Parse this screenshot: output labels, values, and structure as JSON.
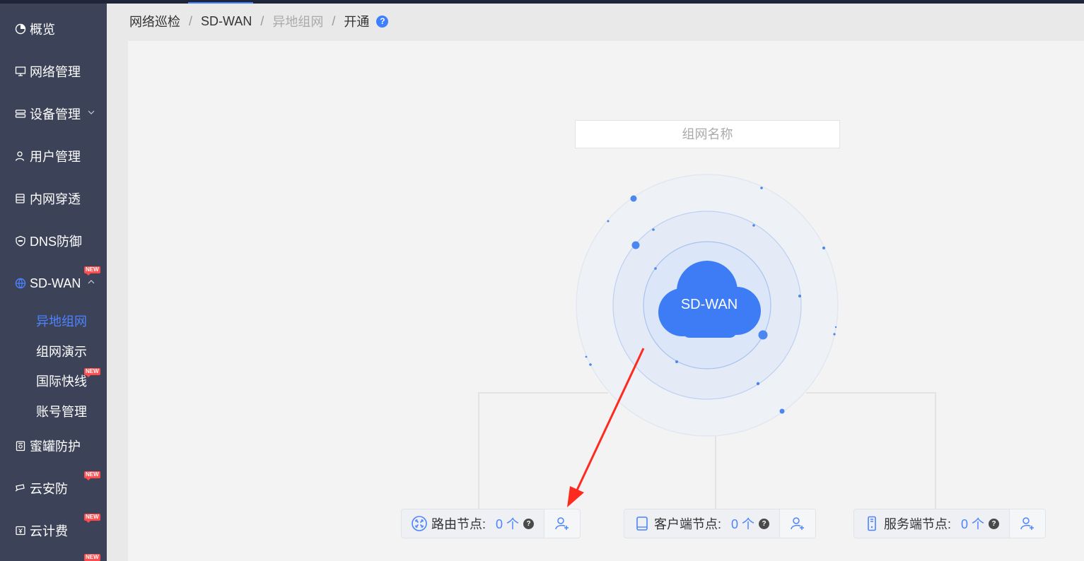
{
  "colors": {
    "accent": "#3d7fff",
    "sidebar_bg": "#3c4257",
    "active_sub": "#4d83ff",
    "badge": "#ff4d4f",
    "arrow": "#ff2a1f"
  },
  "sidebar": {
    "items": [
      {
        "label": "概览",
        "icon": "pie-chart-icon"
      },
      {
        "label": "网络管理",
        "icon": "monitor-icon"
      },
      {
        "label": "设备管理",
        "icon": "server-icon"
      },
      {
        "label": "用户管理",
        "icon": "user-icon"
      },
      {
        "label": "内网穿透",
        "icon": "database-icon"
      },
      {
        "label": "DNS防御",
        "icon": "shield-icon"
      },
      {
        "label": "SD-WAN",
        "icon": "globe-icon",
        "badge": "NEW"
      },
      {
        "label": "蜜罐防护",
        "icon": "lock-box-icon"
      },
      {
        "label": "云安防",
        "icon": "camera-icon",
        "badge": "NEW"
      },
      {
        "label": "云计费",
        "icon": "billing-icon",
        "badge": "NEW"
      }
    ],
    "sdwan_sub": [
      {
        "label": "异地组网",
        "active": true
      },
      {
        "label": "组网演示"
      },
      {
        "label": "国际快线",
        "badge": "NEW"
      },
      {
        "label": "账号管理"
      }
    ],
    "bottom_badge": "NEW"
  },
  "breadcrumb": {
    "items": [
      "网络巡检",
      "SD-WAN",
      "异地组网",
      "开通"
    ],
    "help": "?"
  },
  "form": {
    "name_placeholder": "组网名称"
  },
  "cloud": {
    "label": "SD-WAN"
  },
  "nodes": [
    {
      "label": "路由节点:",
      "count": "0 个",
      "help": "?",
      "icon": "router-icon"
    },
    {
      "label": "客户端节点:",
      "count": "0 个",
      "help": "?",
      "icon": "tablet-icon"
    },
    {
      "label": "服务端节点:",
      "count": "0 个",
      "help": "?",
      "icon": "server-tower-icon"
    }
  ]
}
